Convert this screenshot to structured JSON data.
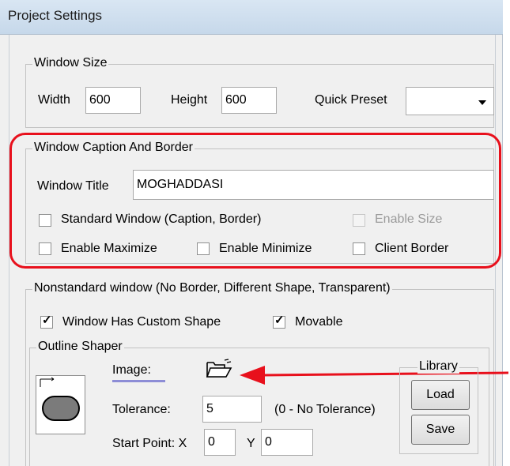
{
  "window": {
    "title": "Project Settings"
  },
  "window_size": {
    "legend": "Window Size",
    "width_label": "Width",
    "width_value": "600",
    "height_label": "Height",
    "height_value": "600",
    "preset_label": "Quick Preset",
    "preset_value": ""
  },
  "caption_border": {
    "legend": "Window Caption And Border",
    "title_label": "Window Title",
    "title_value": "MOGHADDASI",
    "standard_window": "Standard Window (Caption, Border)",
    "enable_size": "Enable Size",
    "enable_maximize": "Enable Maximize",
    "enable_minimize": "Enable Minimize",
    "client_border": "Client Border"
  },
  "nonstandard": {
    "legend": "Nonstandard window (No Border, Different Shape, Transparent)",
    "custom_shape": "Window Has Custom Shape",
    "movable": "Movable"
  },
  "outline_shaper": {
    "legend": "Outline Shaper",
    "image_label": "Image:",
    "tolerance_label": "Tolerance:",
    "tolerance_value": "5",
    "tolerance_hint": "(0 - No Tolerance)",
    "start_point_label": "Start Point: X",
    "x_value": "0",
    "y_label": "Y",
    "y_value": "0",
    "library": {
      "legend": "Library",
      "load": "Load",
      "save": "Save"
    }
  },
  "icons": {
    "folder": "open-folder-icon",
    "arrow": "red-arrow-icon",
    "shape_preview": "rounded-shape-preview-icon"
  },
  "colors": {
    "highlight": "#e8101c",
    "accent_line": "#8d8dd6"
  }
}
